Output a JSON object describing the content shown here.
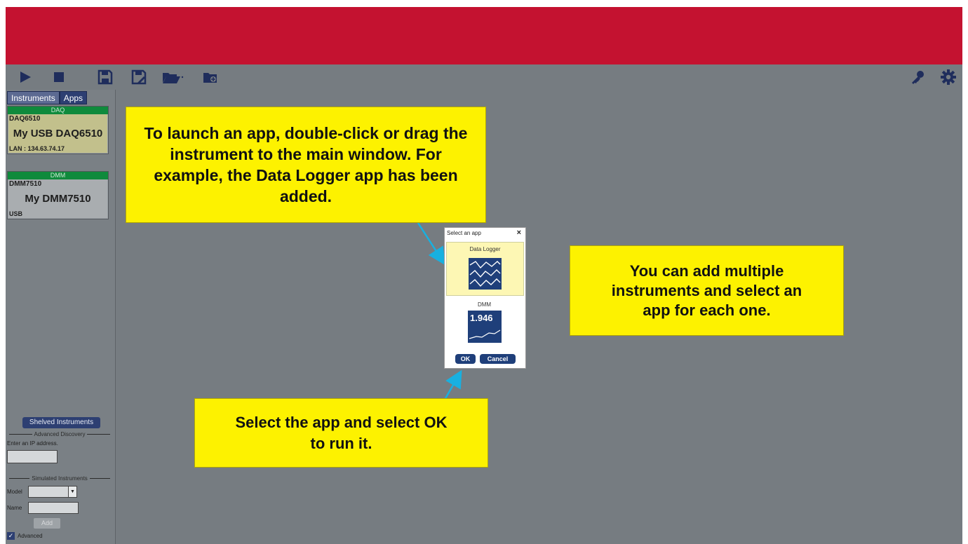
{
  "colors": {
    "banner": "#c41230",
    "app_bg": "#767c81",
    "callout": "#fdf200",
    "accent": "#2d3f72",
    "daq_header": "#0f8a3c",
    "arrow": "#18b0e0"
  },
  "toolbar": {
    "icons": [
      "play-icon",
      "stop-icon",
      "save-icon",
      "save-as-icon",
      "open-folder-icon",
      "new-folder-icon",
      "key-icon",
      "gear-icon"
    ]
  },
  "sidebar": {
    "tabs": [
      {
        "label": "Instruments",
        "active": true
      },
      {
        "label": "Apps",
        "active": false
      }
    ],
    "instruments": [
      {
        "type": "DAQ",
        "model": "DAQ6510",
        "name": "My USB DAQ6510",
        "connection": "LAN : 134.63.74.17"
      },
      {
        "type": "DMM",
        "model": "DMM7510",
        "name": "My DMM7510",
        "connection": "USB"
      }
    ],
    "shelved_button": "Shelved Instruments",
    "advanced_discovery": {
      "heading": "Advanced Discovery",
      "prompt": "Enter an IP address."
    },
    "simulated": {
      "heading": "Simulated Instruments",
      "model_label": "Model",
      "name_label": "Name",
      "add_button": "Add"
    },
    "advanced_label": "Advanced"
  },
  "dialog": {
    "title": "Select an app",
    "close": "×",
    "apps": [
      {
        "name": "Data Logger",
        "selected": true
      },
      {
        "name": "DMM",
        "selected": false,
        "reading": "1.946"
      }
    ],
    "ok": "OK",
    "cancel": "Cancel"
  },
  "callouts": {
    "launch": "To launch an app, double-click or drag the instrument to the main window. For example, the Data Logger app has been added.",
    "multiple": "You can add multiple instruments and select an app for each one.",
    "select": "Select the app and select OK to run it."
  }
}
